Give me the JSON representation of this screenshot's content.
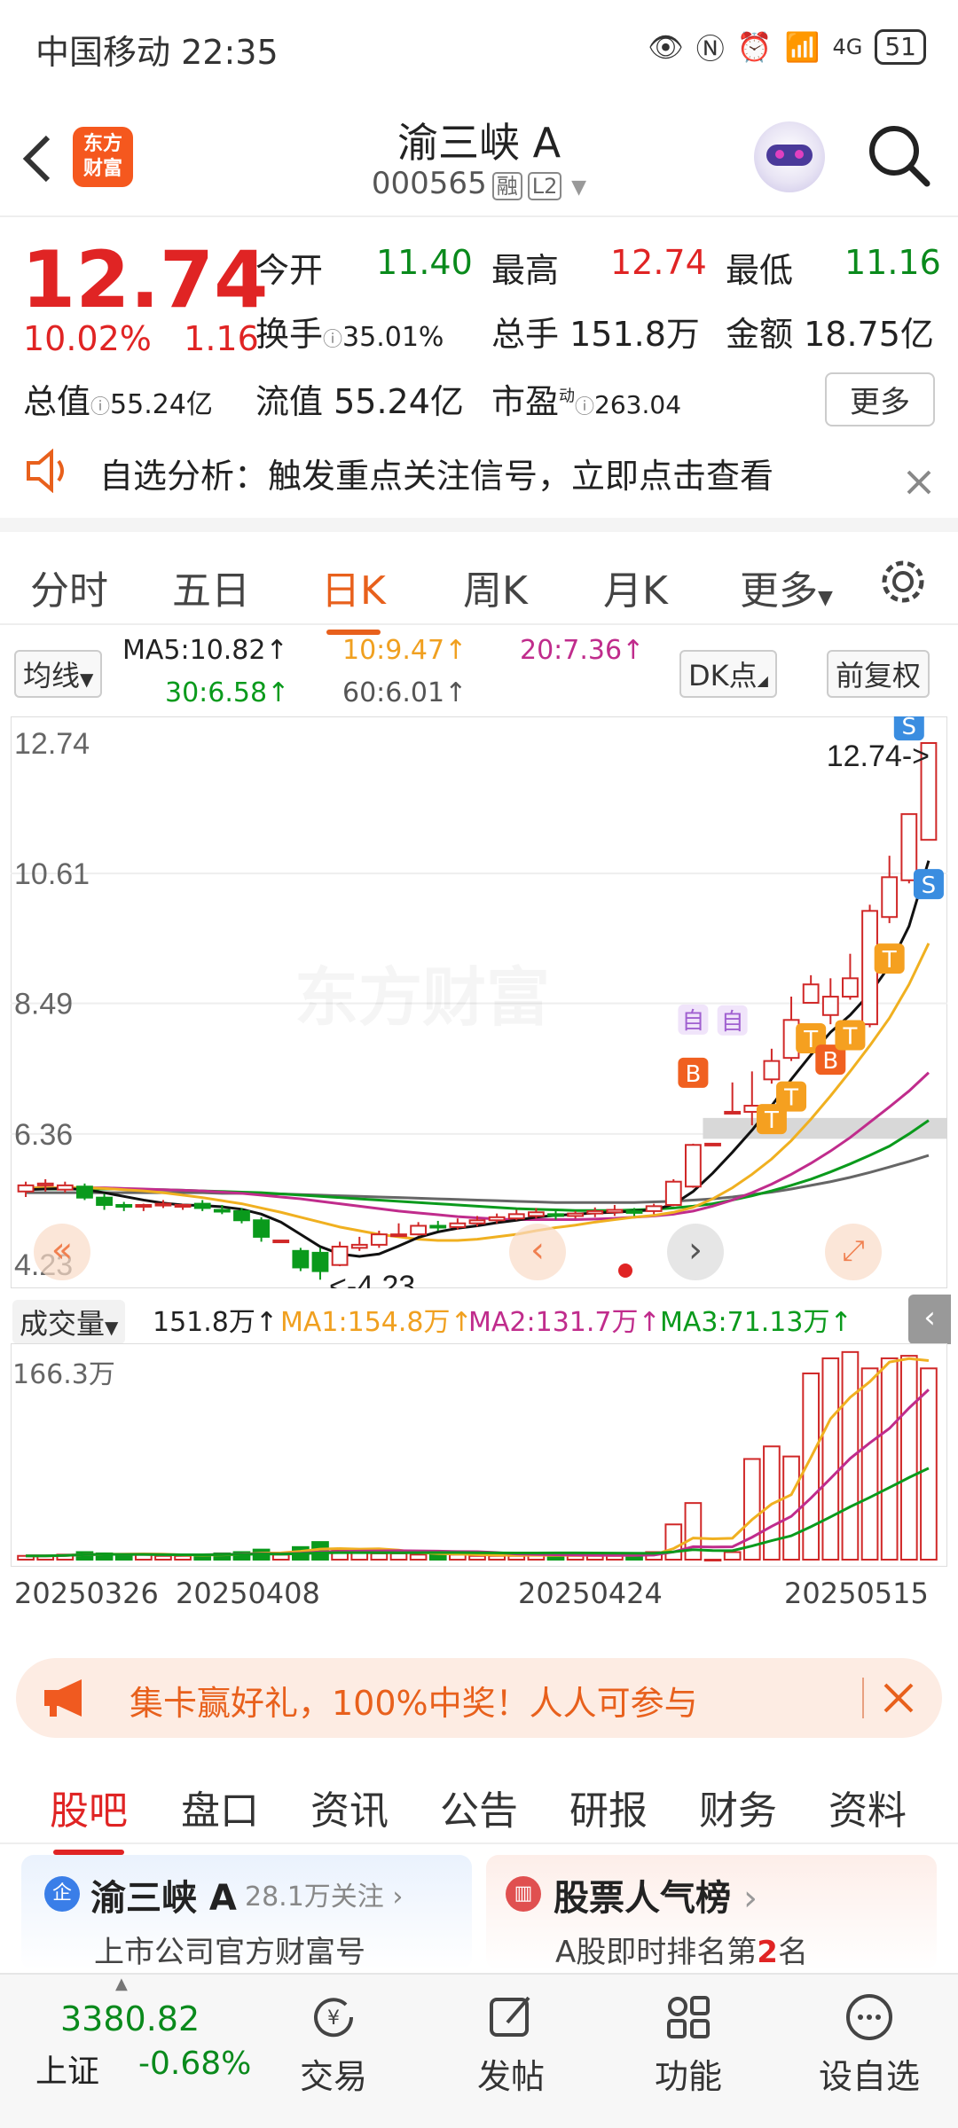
{
  "status_bar": {
    "carrier": "中国移动",
    "time": "22:35",
    "network": "4G",
    "battery": "51"
  },
  "header": {
    "name": "渝三峡 A",
    "code": "000565",
    "tag1": "融",
    "tag2": "L2",
    "logo_line1": "东方",
    "logo_line2": "财富"
  },
  "quote": {
    "price": "12.74",
    "pct": "10.02%",
    "chg": "1.16",
    "open_label": "今开",
    "open": "11.40",
    "high_label": "最高",
    "high": "12.74",
    "low_label": "最低",
    "low": "11.16",
    "turnover_label": "换手",
    "turnover": "35.01%",
    "vol_label": "总手",
    "vol": "151.8万",
    "amt_label": "金额",
    "amt": "18.75亿",
    "mcap_label": "总值",
    "mcap": "55.24亿",
    "float_label": "流值",
    "float": "55.24亿",
    "pe_label": "市盈",
    "pe_sup": "动",
    "pe": "263.04",
    "more": "更多"
  },
  "notice": {
    "text": "自选分析：触发重点关注信号，立即点击查看"
  },
  "ktabs": [
    "分时",
    "五日",
    "日K",
    "周K",
    "月K",
    "更多"
  ],
  "ma": {
    "btn": "均线",
    "ma5": "MA5:10.82↑",
    "ma10": "10:9.47↑",
    "ma20": "20:7.36↑",
    "ma30": "30:6.58↑",
    "ma60": "60:6.01↑",
    "dk": "DK点",
    "fq": "前复权"
  },
  "chart_data": {
    "type": "candlestick",
    "y_ticks": [
      "12.74",
      "10.61",
      "8.49",
      "6.36",
      "4.23"
    ],
    "ylim": [
      4.23,
      12.74
    ],
    "max_label": "12.74->",
    "min_label": "<-4.23",
    "watermark": "东方财富",
    "candles": [
      [
        5.42,
        5.52,
        5.58,
        5.33
      ],
      [
        5.52,
        5.55,
        5.62,
        5.42
      ],
      [
        5.45,
        5.52,
        5.58,
        5.4
      ],
      [
        5.5,
        5.32,
        5.55,
        5.28
      ],
      [
        5.32,
        5.2,
        5.38,
        5.12
      ],
      [
        5.2,
        5.18,
        5.25,
        5.1
      ],
      [
        5.18,
        5.2,
        5.22,
        5.1
      ],
      [
        5.22,
        5.22,
        5.28,
        5.15
      ],
      [
        5.18,
        5.2,
        5.22,
        5.12
      ],
      [
        5.22,
        5.15,
        5.28,
        5.1
      ],
      [
        5.12,
        5.1,
        5.2,
        5.05
      ],
      [
        5.1,
        4.95,
        5.15,
        4.9
      ],
      [
        4.95,
        4.68,
        5.0,
        4.6
      ],
      [
        4.62,
        4.62,
        4.62,
        4.62
      ],
      [
        4.45,
        4.18,
        4.5,
        4.12
      ],
      [
        4.42,
        4.12,
        4.5,
        3.98
      ],
      [
        4.22,
        4.52,
        4.6,
        4.2
      ],
      [
        4.5,
        4.55,
        4.68,
        4.45
      ],
      [
        4.55,
        4.72,
        4.78,
        4.5
      ],
      [
        4.72,
        4.72,
        4.9,
        4.68
      ],
      [
        4.72,
        4.86,
        4.92,
        4.7
      ],
      [
        4.86,
        4.84,
        4.94,
        4.78
      ],
      [
        4.84,
        4.9,
        4.98,
        4.8
      ],
      [
        4.9,
        4.95,
        5.02,
        4.85
      ],
      [
        4.95,
        5.0,
        5.06,
        4.9
      ],
      [
        4.98,
        5.05,
        5.12,
        4.95
      ],
      [
        5.02,
        5.08,
        5.15,
        4.98
      ],
      [
        5.05,
        5.02,
        5.12,
        4.96
      ],
      [
        5.02,
        5.06,
        5.1,
        4.98
      ],
      [
        5.06,
        5.1,
        5.16,
        5.0
      ],
      [
        5.08,
        5.12,
        5.2,
        5.02
      ],
      [
        5.1,
        5.08,
        5.15,
        5.02
      ],
      [
        5.1,
        5.18,
        5.22,
        5.05
      ],
      [
        5.2,
        5.58,
        5.62,
        5.18
      ],
      [
        5.5,
        6.18,
        6.2,
        5.48
      ],
      [
        6.2,
        6.2,
        6.2,
        6.2
      ],
      [
        6.72,
        6.72,
        7.2,
        6.72
      ],
      [
        6.72,
        6.82,
        7.38,
        6.5
      ],
      [
        7.25,
        7.55,
        7.75,
        7.18
      ],
      [
        7.6,
        8.22,
        8.6,
        7.55
      ],
      [
        8.5,
        8.8,
        8.95,
        8.5
      ],
      [
        8.3,
        8.6,
        8.9,
        8.15
      ],
      [
        8.6,
        8.9,
        9.3,
        8.55
      ],
      [
        8.15,
        10.0,
        10.1,
        8.1
      ],
      [
        9.9,
        10.55,
        10.9,
        9.8
      ],
      [
        10.5,
        11.58,
        11.58,
        10.45
      ],
      [
        11.16,
        12.74,
        12.74,
        11.16
      ]
    ],
    "ma5": [
      5.45,
      5.46,
      5.47,
      5.45,
      5.4,
      5.34,
      5.28,
      5.23,
      5.2,
      5.19,
      5.17,
      5.13,
      5.05,
      4.92,
      4.72,
      4.52,
      4.4,
      4.36,
      4.4,
      4.53,
      4.67,
      4.76,
      4.82,
      4.86,
      4.91,
      4.95,
      5.0,
      5.03,
      5.05,
      5.07,
      5.08,
      5.1,
      5.12,
      5.21,
      5.42,
      5.72,
      6.06,
      6.42,
      6.82,
      7.25,
      7.65,
      8.02,
      8.3,
      8.65,
      9.1,
      9.75,
      10.82
    ],
    "ma10": [
      5.48,
      5.48,
      5.48,
      5.48,
      5.47,
      5.45,
      5.43,
      5.4,
      5.36,
      5.32,
      5.27,
      5.22,
      5.15,
      5.08,
      5.0,
      4.92,
      4.84,
      4.78,
      4.72,
      4.68,
      4.64,
      4.62,
      4.62,
      4.64,
      4.68,
      4.72,
      4.78,
      4.83,
      4.87,
      4.92,
      4.96,
      5.0,
      5.03,
      5.08,
      5.16,
      5.3,
      5.48,
      5.7,
      5.95,
      6.25,
      6.6,
      6.98,
      7.38,
      7.8,
      8.25,
      8.8,
      9.47
    ],
    "ma20": [
      5.48,
      5.48,
      5.48,
      5.48,
      5.48,
      5.47,
      5.46,
      5.45,
      5.44,
      5.43,
      5.41,
      5.39,
      5.36,
      5.33,
      5.3,
      5.26,
      5.22,
      5.18,
      5.14,
      5.1,
      5.07,
      5.04,
      5.01,
      4.99,
      4.97,
      4.96,
      4.96,
      4.96,
      4.96,
      4.97,
      4.98,
      5.0,
      5.02,
      5.05,
      5.1,
      5.18,
      5.28,
      5.4,
      5.54,
      5.7,
      5.88,
      6.08,
      6.3,
      6.55,
      6.8,
      7.06,
      7.36
    ],
    "ma30": [
      5.46,
      5.46,
      5.46,
      5.46,
      5.46,
      5.46,
      5.45,
      5.45,
      5.44,
      5.43,
      5.42,
      5.41,
      5.4,
      5.38,
      5.36,
      5.34,
      5.32,
      5.3,
      5.28,
      5.26,
      5.24,
      5.22,
      5.2,
      5.18,
      5.16,
      5.14,
      5.13,
      5.12,
      5.11,
      5.11,
      5.11,
      5.12,
      5.13,
      5.15,
      5.18,
      5.22,
      5.28,
      5.35,
      5.43,
      5.52,
      5.62,
      5.74,
      5.87,
      6.01,
      6.16,
      6.36,
      6.58
    ],
    "ma60": [
      5.4,
      5.4,
      5.4,
      5.4,
      5.4,
      5.4,
      5.4,
      5.4,
      5.4,
      5.4,
      5.39,
      5.39,
      5.38,
      5.38,
      5.37,
      5.36,
      5.35,
      5.34,
      5.33,
      5.32,
      5.31,
      5.3,
      5.29,
      5.28,
      5.27,
      5.26,
      5.25,
      5.24,
      5.24,
      5.24,
      5.24,
      5.24,
      5.25,
      5.26,
      5.28,
      5.3,
      5.33,
      5.37,
      5.41,
      5.46,
      5.52,
      5.58,
      5.65,
      5.73,
      5.82,
      5.91,
      6.01
    ],
    "signals": [
      {
        "i": 34,
        "t": "B",
        "c": "#f06020"
      },
      {
        "i": 34,
        "t": "自",
        "c": "#a060d0"
      },
      {
        "i": 36,
        "t": "自",
        "c": "#a060d0"
      },
      {
        "i": 38,
        "t": "T",
        "c": "#f5a020"
      },
      {
        "i": 39,
        "t": "T",
        "c": "#f5a020"
      },
      {
        "i": 40,
        "t": "T",
        "c": "#f5a020"
      },
      {
        "i": 41,
        "t": "B",
        "c": "#f06020"
      },
      {
        "i": 42,
        "t": "T",
        "c": "#f5a020"
      },
      {
        "i": 44,
        "t": "T",
        "c": "#f5a020"
      },
      {
        "i": 45,
        "t": "S",
        "c": "#3a8de0"
      },
      {
        "i": 46,
        "t": "S",
        "c": "#3a8de0"
      }
    ]
  },
  "volume": {
    "label": "成交量",
    "value": "151.8万↑",
    "ma1": "MA1:154.8万↑",
    "ma2": "MA2:131.7万↑",
    "ma3": "MA3:71.13万↑",
    "max": "166.3万",
    "dates": [
      "20250326",
      "20250408",
      "20250424",
      "20250515"
    ],
    "bars": [
      3,
      3,
      4,
      6,
      5,
      4,
      4,
      3,
      3,
      4,
      5,
      6,
      8,
      4,
      10,
      14,
      8,
      6,
      5,
      5,
      4,
      4,
      4,
      3,
      3,
      3,
      4,
      4,
      3,
      3,
      3,
      4,
      6,
      28,
      45,
      0,
      6,
      80,
      90,
      82,
      148,
      160,
      165,
      152,
      160,
      162,
      152
    ]
  },
  "banner": {
    "text": "集卡赢好礼，100%中奖！人人可参与"
  },
  "btabs": [
    "股吧",
    "盘口",
    "资讯",
    "公告",
    "研报",
    "财务",
    "资料"
  ],
  "card1": {
    "title": "渝三峡 A",
    "follow": "28.1万关注",
    "sub": "上市公司官方财富号",
    "badge": "企"
  },
  "card2": {
    "title": "股票人气榜",
    "sub_pre": "A股即时排名第",
    "rank": "2",
    "sub_post": "名"
  },
  "bnav": {
    "index_val": "3380.82",
    "index_name": "上证",
    "index_chg": "-0.68%",
    "items": [
      "交易",
      "发帖",
      "功能",
      "设自选"
    ]
  }
}
